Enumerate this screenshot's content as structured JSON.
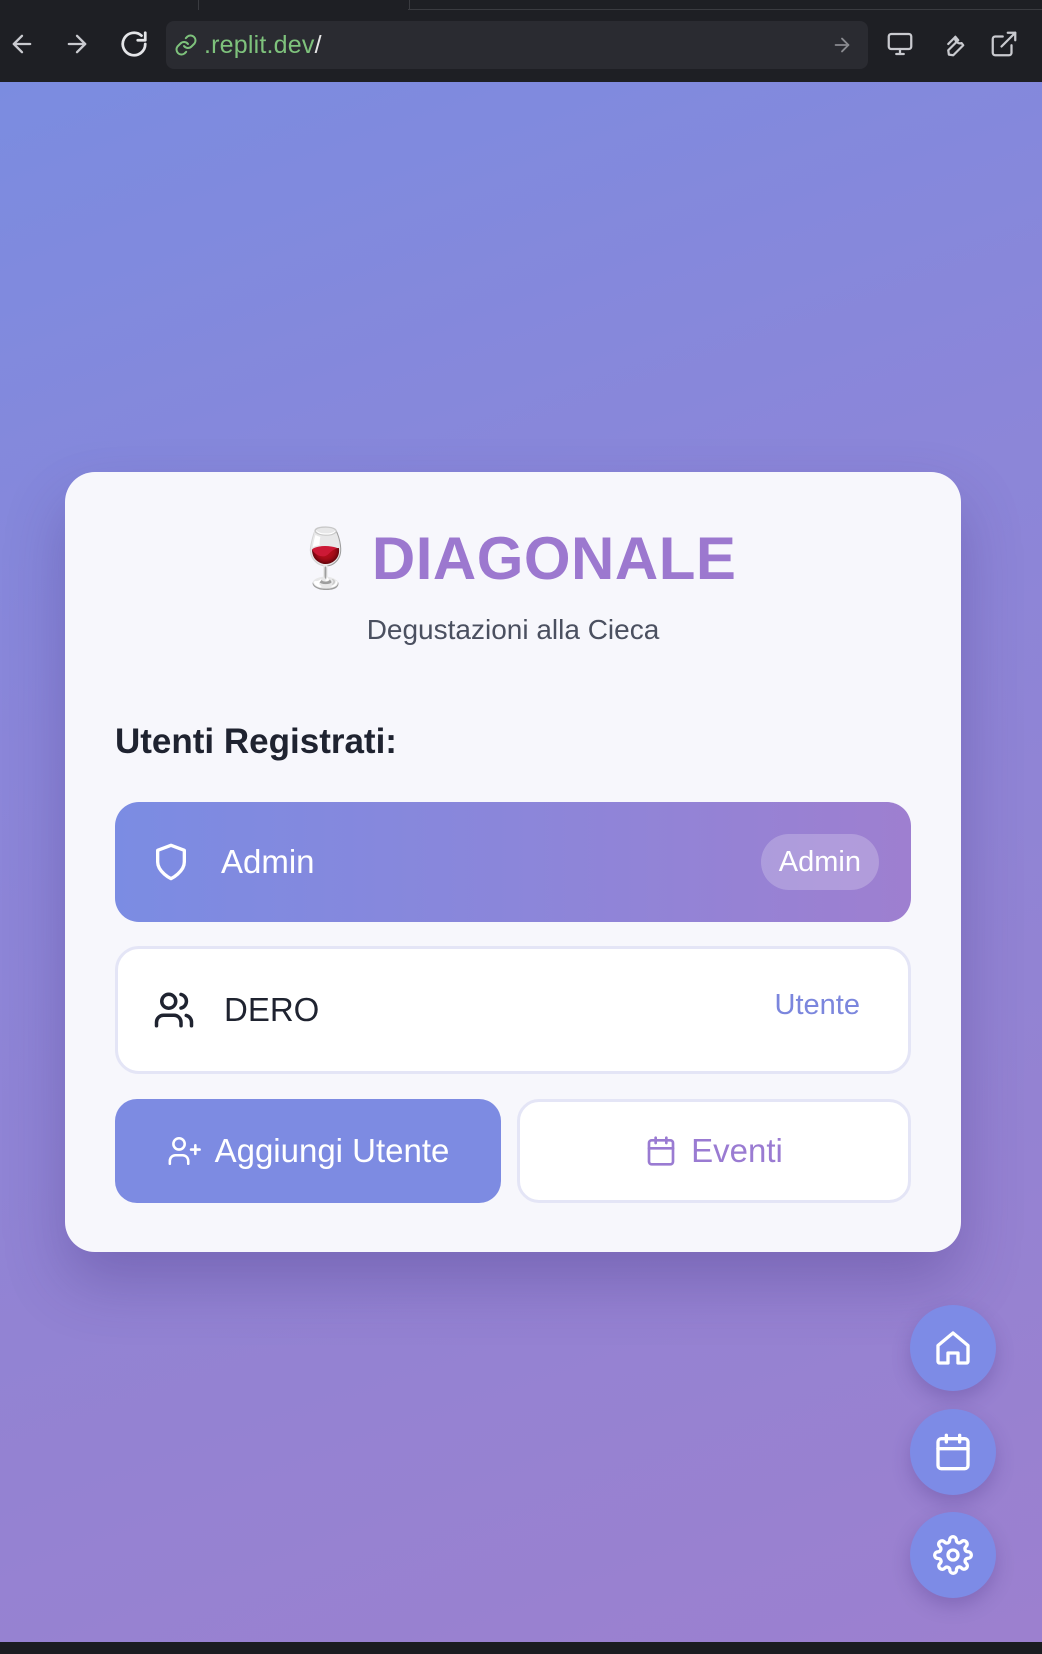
{
  "browser": {
    "url_domain": ".replit.dev",
    "url_path": "/"
  },
  "app": {
    "logo_emoji": "🍷",
    "title": "DIAGONALE",
    "subtitle": "Degustazioni alla Cieca",
    "section_label": "Utenti Registrati:"
  },
  "users": [
    {
      "name": "Admin",
      "role": "Admin",
      "icon": "shield-icon"
    },
    {
      "name": "DERO",
      "role": "Utente",
      "icon": "users-icon"
    }
  ],
  "actions": {
    "add_user_label": "Aggiungi Utente",
    "events_label": "Eventi"
  },
  "fabs": [
    {
      "icon": "home-icon"
    },
    {
      "icon": "calendar-icon"
    },
    {
      "icon": "gear-icon"
    }
  ],
  "colors": {
    "accent": "#7d8be2",
    "title": "#9c78cf",
    "gradient_start": "#7b8ce0",
    "gradient_end": "#9c80cf"
  }
}
